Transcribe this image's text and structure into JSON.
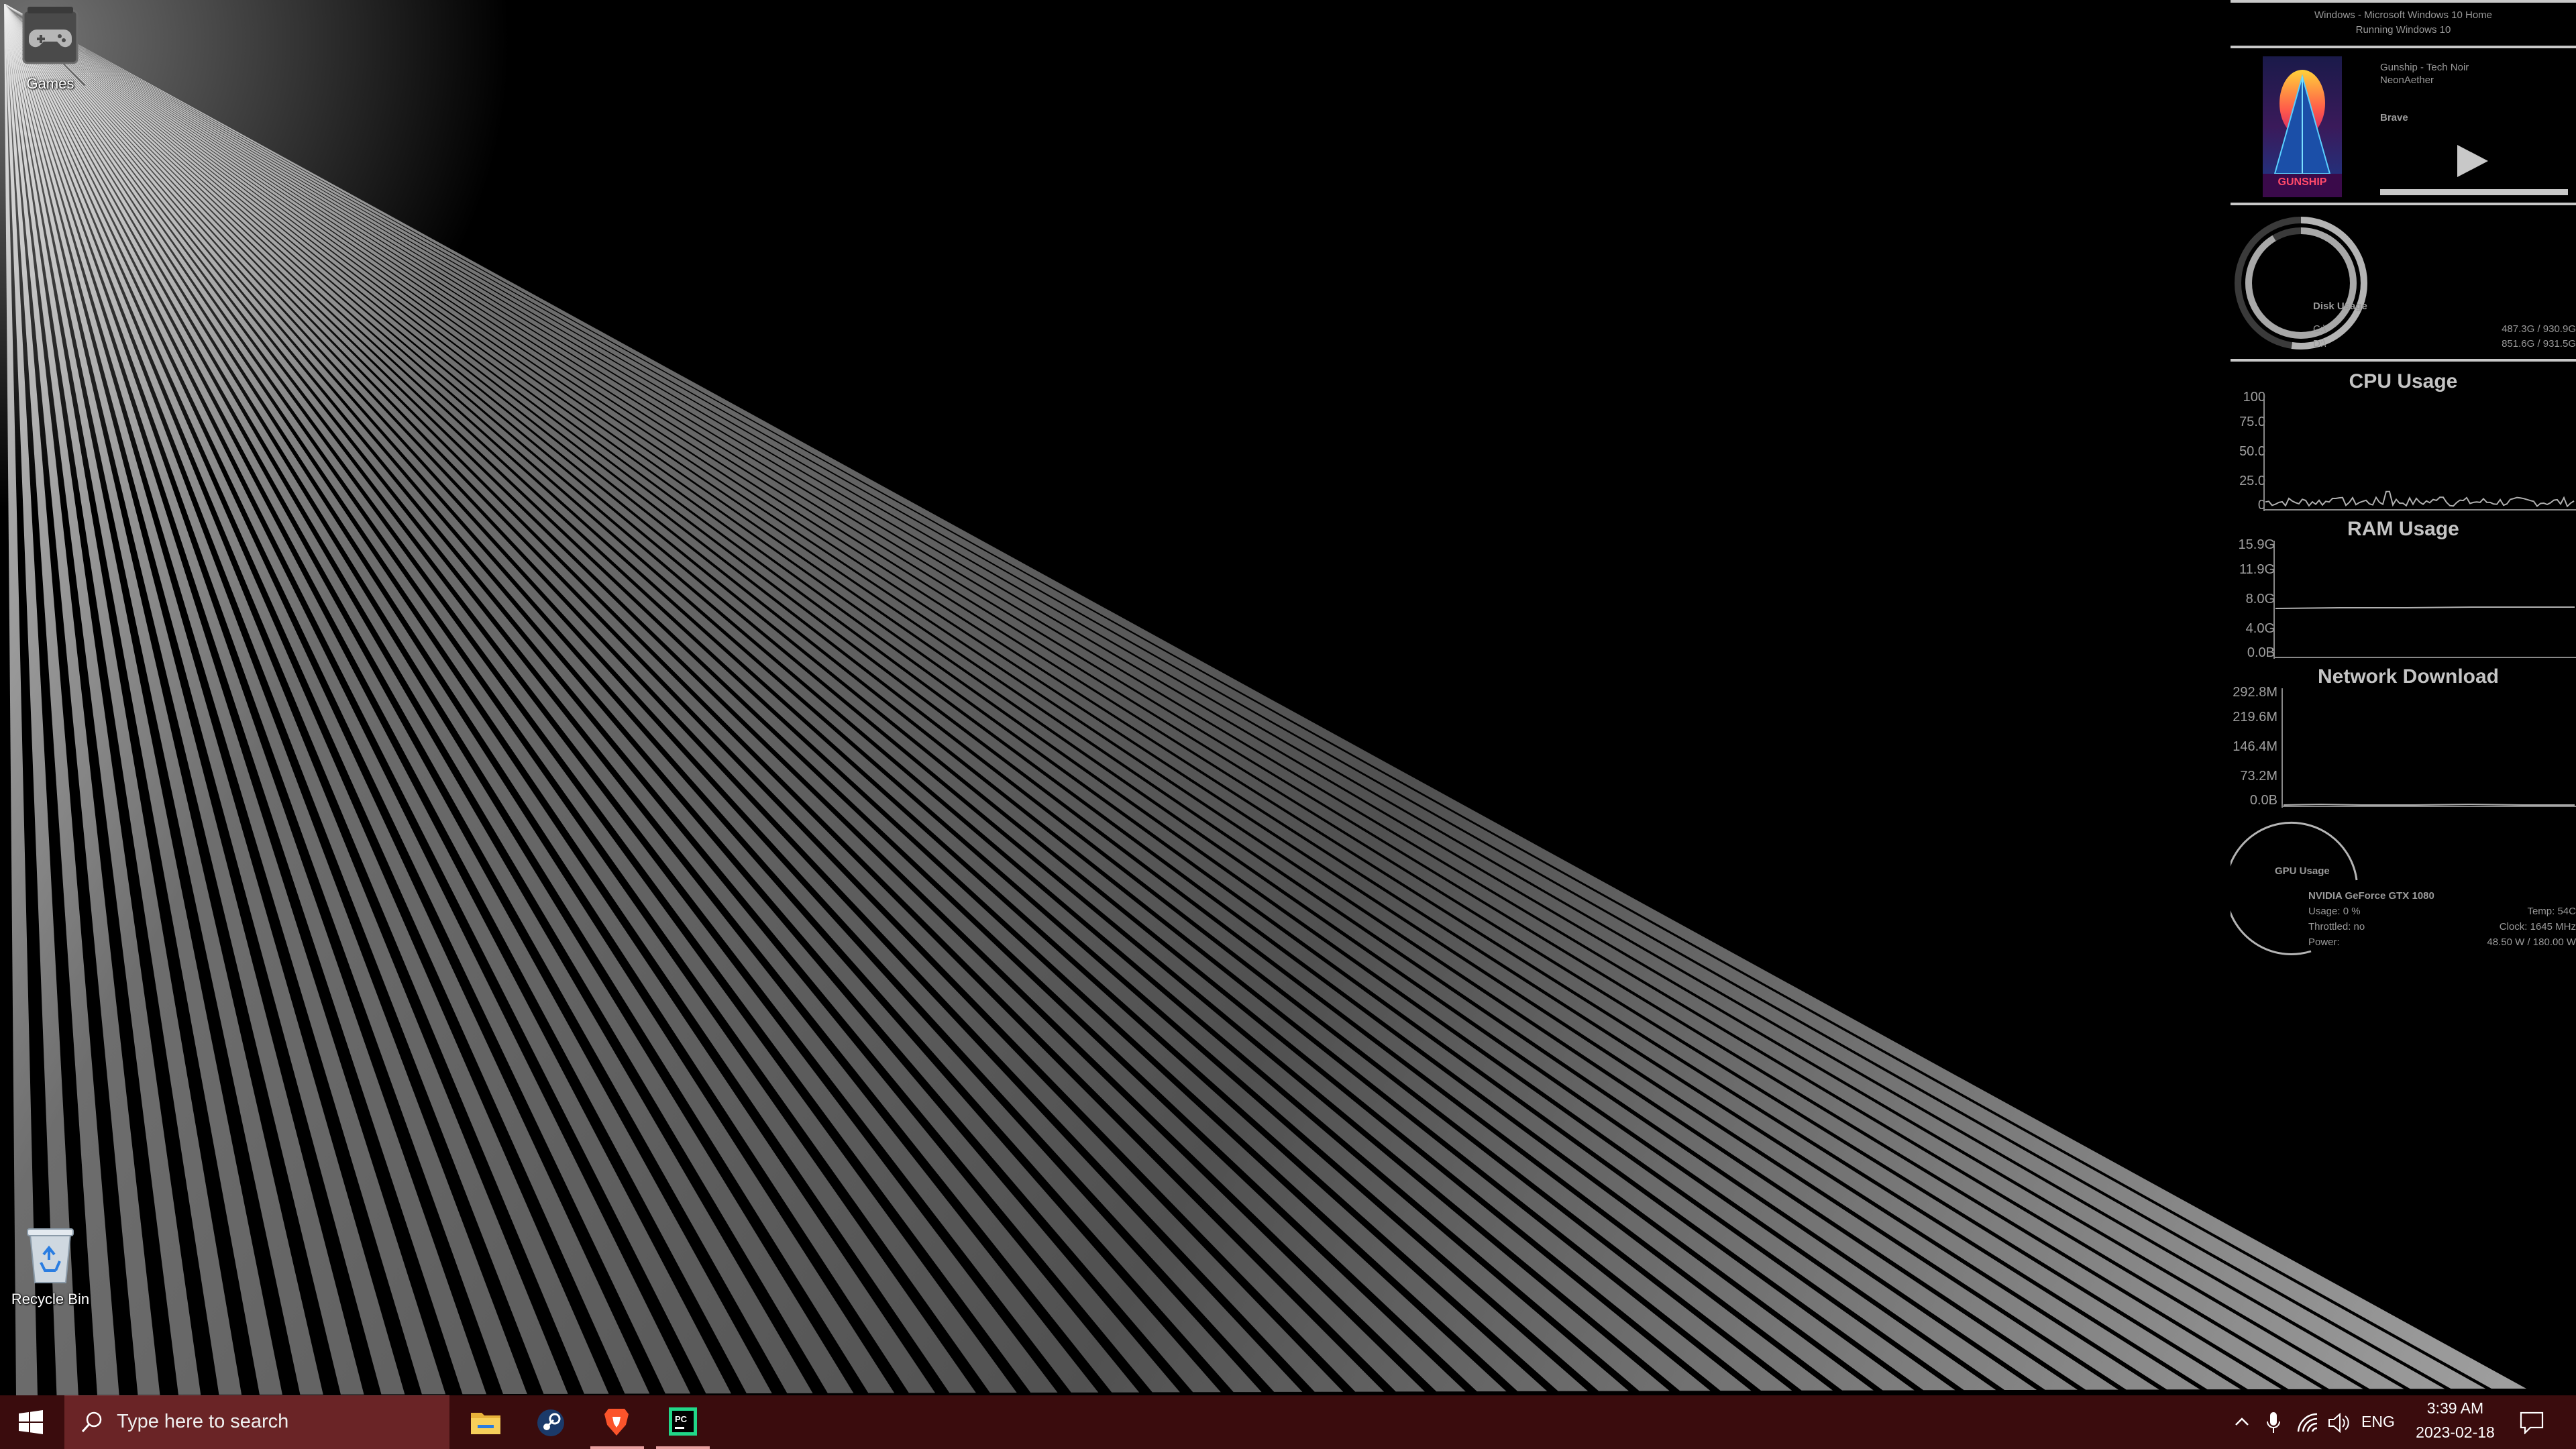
{
  "desktop": {
    "icons": {
      "games": "Games",
      "recycle_bin": "Recycle Bin"
    }
  },
  "widgets": {
    "system": {
      "line1": "Windows - Microsoft Windows 10 Home",
      "line2": "Running Windows 10"
    },
    "media": {
      "track": "Gunship - Tech Noir",
      "artist": "NeonAether",
      "player": "Brave",
      "album_art_text": "GUNSHIP"
    },
    "disk": {
      "title": "Disk Usage",
      "drives": [
        {
          "name": "C:\\",
          "usage": "487.3G / 930.9G",
          "fraction": 0.523
        },
        {
          "name": "D:\\",
          "usage": "851.6G / 931.5G",
          "fraction": 0.914
        }
      ]
    },
    "cpu": {
      "title": "CPU Usage",
      "axis": [
        "100",
        "75.0",
        "50.0",
        "25.0",
        "0"
      ]
    },
    "ram": {
      "title": "RAM Usage",
      "axis": [
        "15.9G",
        "11.9G",
        "8.0G",
        "4.0G",
        "0.0B"
      ]
    },
    "network": {
      "title": "Network Download",
      "axis": [
        "292.8M",
        "219.6M",
        "146.4M",
        "73.2M",
        "0.0B"
      ]
    },
    "gpu": {
      "title": "GPU Usage",
      "name": "NVIDIA GeForce GTX 1080",
      "usage": "Usage: 0 %",
      "temp": "Temp: 54C",
      "throttled": "Throttled: no",
      "clock": "Clock: 1645 MHz",
      "power_label": "Power:",
      "power_value": "48.50 W / 180.00 W"
    }
  },
  "taskbar": {
    "search_placeholder": "Type here to search",
    "apps": [
      "file-explorer",
      "steam",
      "brave",
      "pycharm"
    ],
    "tray": {
      "language": "ENG",
      "time": "3:39 AM",
      "date": "2023-02-18"
    }
  },
  "colors": {
    "taskbar_bg": "#3a0c0d",
    "searchbox_bg": "#6a2426",
    "widget_rule": "#c8c8c8"
  }
}
